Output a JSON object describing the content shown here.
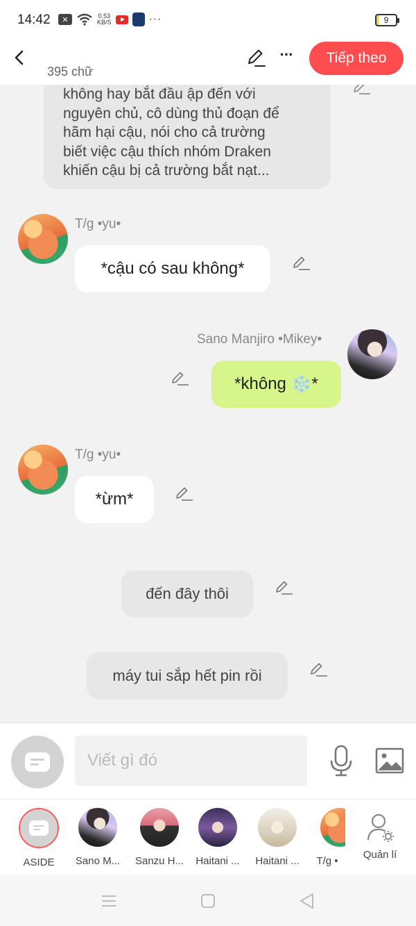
{
  "status_bar": {
    "time": "14:42",
    "speed_value": "0.53",
    "speed_unit": "KB/S",
    "battery_level": "9",
    "icons": [
      "notification-x-icon",
      "wifi-icon",
      "youtube-icon",
      "shield-icon",
      "more-dots-icon"
    ]
  },
  "header": {
    "word_count": "395 chữ",
    "next_label": "Tiếp theo",
    "accent_color": "#ff4d4f"
  },
  "narration_top": {
    "lines": [
      "không hay bắt đầu ập đến với",
      "nguyên chủ, cô dùng thủ đoạn để",
      "hãm hại cậu, nói  cho cả trường",
      "biết việc cậu thích nhóm Draken",
      "khiến cậu bị cả trường bắt nạt..."
    ]
  },
  "messages": [
    {
      "sender": "T/g •yu•",
      "text": "*cậu có sau không*",
      "side": "left"
    },
    {
      "sender": "Sano Manjiro •Mikey•",
      "text_before": "*không ",
      "emoji": "❄️",
      "text_after": "*",
      "side": "right",
      "bubble_color": "#d6f58a"
    },
    {
      "sender": "T/g •yu•",
      "text": "*ừm*",
      "side": "left"
    },
    {
      "text": "đến đây thôi",
      "side": "center"
    },
    {
      "text": "máy tui sắp hết pin rồi",
      "side": "center"
    }
  ],
  "composer": {
    "placeholder": "Viết gì đó"
  },
  "characters": [
    {
      "label": "ASIDE"
    },
    {
      "label": "Sano M..."
    },
    {
      "label": "Sanzu H..."
    },
    {
      "label": "Haitani ..."
    },
    {
      "label": "Haitani ..."
    },
    {
      "label": "T/g •"
    }
  ],
  "manage_label": "Quản lí"
}
